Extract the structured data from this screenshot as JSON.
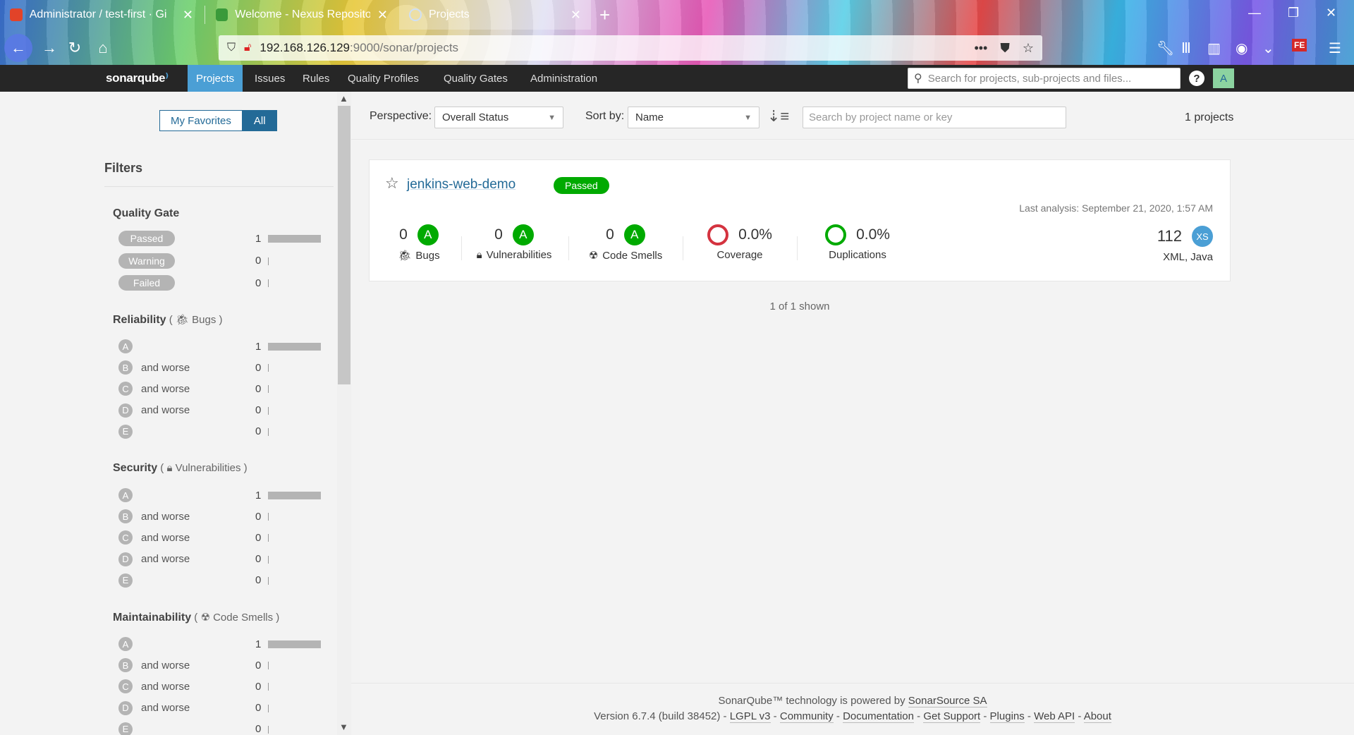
{
  "browser": {
    "tabs": [
      {
        "title": "Administrator / test-first · Gi",
        "favicon_color": "#e24329"
      },
      {
        "title": "Welcome - Nexus Repositor",
        "favicon_color": "#3a9a3a"
      },
      {
        "title": "Projects",
        "favicon_color": "#7aa7d8"
      }
    ],
    "url_host": "192.168.126.129",
    "url_path": ":9000/sonar/projects"
  },
  "header": {
    "logo": "sonarqube",
    "nav": [
      "Projects",
      "Issues",
      "Rules",
      "Quality Profiles",
      "Quality Gates",
      "Administration"
    ],
    "search_placeholder": "Search for projects, sub-projects and files...",
    "help": "?",
    "avatar": "A"
  },
  "sidebar": {
    "favorites_label": "My Favorites",
    "all_label": "All",
    "filters_title": "Filters",
    "quality_gate": {
      "title": "Quality Gate",
      "rows": [
        {
          "label": "Passed",
          "count": "1",
          "fill": 1.0
        },
        {
          "label": "Warning",
          "count": "0",
          "fill": 0
        },
        {
          "label": "Failed",
          "count": "0",
          "fill": 0
        }
      ]
    },
    "rating_groups": [
      {
        "title": "Reliability",
        "sub_label": "Bugs",
        "rows": [
          {
            "grade": "A",
            "suffix": "",
            "count": "1",
            "fill": 1.0
          },
          {
            "grade": "B",
            "suffix": "and worse",
            "count": "0",
            "fill": 0
          },
          {
            "grade": "C",
            "suffix": "and worse",
            "count": "0",
            "fill": 0
          },
          {
            "grade": "D",
            "suffix": "and worse",
            "count": "0",
            "fill": 0
          },
          {
            "grade": "E",
            "suffix": "",
            "count": "0",
            "fill": 0
          }
        ]
      },
      {
        "title": "Security",
        "sub_label": "Vulnerabilities",
        "rows": [
          {
            "grade": "A",
            "suffix": "",
            "count": "1",
            "fill": 1.0
          },
          {
            "grade": "B",
            "suffix": "and worse",
            "count": "0",
            "fill": 0
          },
          {
            "grade": "C",
            "suffix": "and worse",
            "count": "0",
            "fill": 0
          },
          {
            "grade": "D",
            "suffix": "and worse",
            "count": "0",
            "fill": 0
          },
          {
            "grade": "E",
            "suffix": "",
            "count": "0",
            "fill": 0
          }
        ]
      },
      {
        "title": "Maintainability",
        "sub_label": "Code Smells",
        "rows": [
          {
            "grade": "A",
            "suffix": "",
            "count": "1",
            "fill": 1.0
          },
          {
            "grade": "B",
            "suffix": "and worse",
            "count": "0",
            "fill": 0
          },
          {
            "grade": "C",
            "suffix": "and worse",
            "count": "0",
            "fill": 0
          },
          {
            "grade": "D",
            "suffix": "and worse",
            "count": "0",
            "fill": 0
          },
          {
            "grade": "E",
            "suffix": "",
            "count": "0",
            "fill": 0
          }
        ]
      }
    ]
  },
  "toolbar": {
    "perspective_label": "Perspective:",
    "perspective_value": "Overall Status",
    "sort_label": "Sort by:",
    "sort_value": "Name",
    "search_placeholder": "Search by project name or key",
    "project_count": "1 projects"
  },
  "project": {
    "name": "jenkins-web-demo",
    "gate": "Passed",
    "last_analysis": "Last analysis: September 21, 2020, 1:57 AM",
    "bugs": {
      "value": "0",
      "grade": "A",
      "label": "Bugs"
    },
    "vulnerabilities": {
      "value": "0",
      "grade": "A",
      "label": "Vulnerabilities"
    },
    "code_smells": {
      "value": "0",
      "grade": "A",
      "label": "Code Smells"
    },
    "coverage": {
      "value": "0.0%",
      "label": "Coverage"
    },
    "duplications": {
      "value": "0.0%",
      "label": "Duplications"
    },
    "loc": {
      "value": "112",
      "size": "XS",
      "languages": "XML, Java"
    }
  },
  "shown_text": "1 of 1 shown",
  "footer": {
    "line1_prefix": "SonarQube™ technology is powered by ",
    "line1_link": "SonarSource SA",
    "version": "Version 6.7.4 (build 38452) - ",
    "links": [
      "LGPL v3",
      "Community",
      "Documentation",
      "Get Support",
      "Plugins",
      "Web API",
      "About"
    ]
  },
  "colors": {
    "accent": "#4b9fd5",
    "link": "#236a97",
    "passed": "#00aa00",
    "coverage_ring": "#d4333f"
  }
}
